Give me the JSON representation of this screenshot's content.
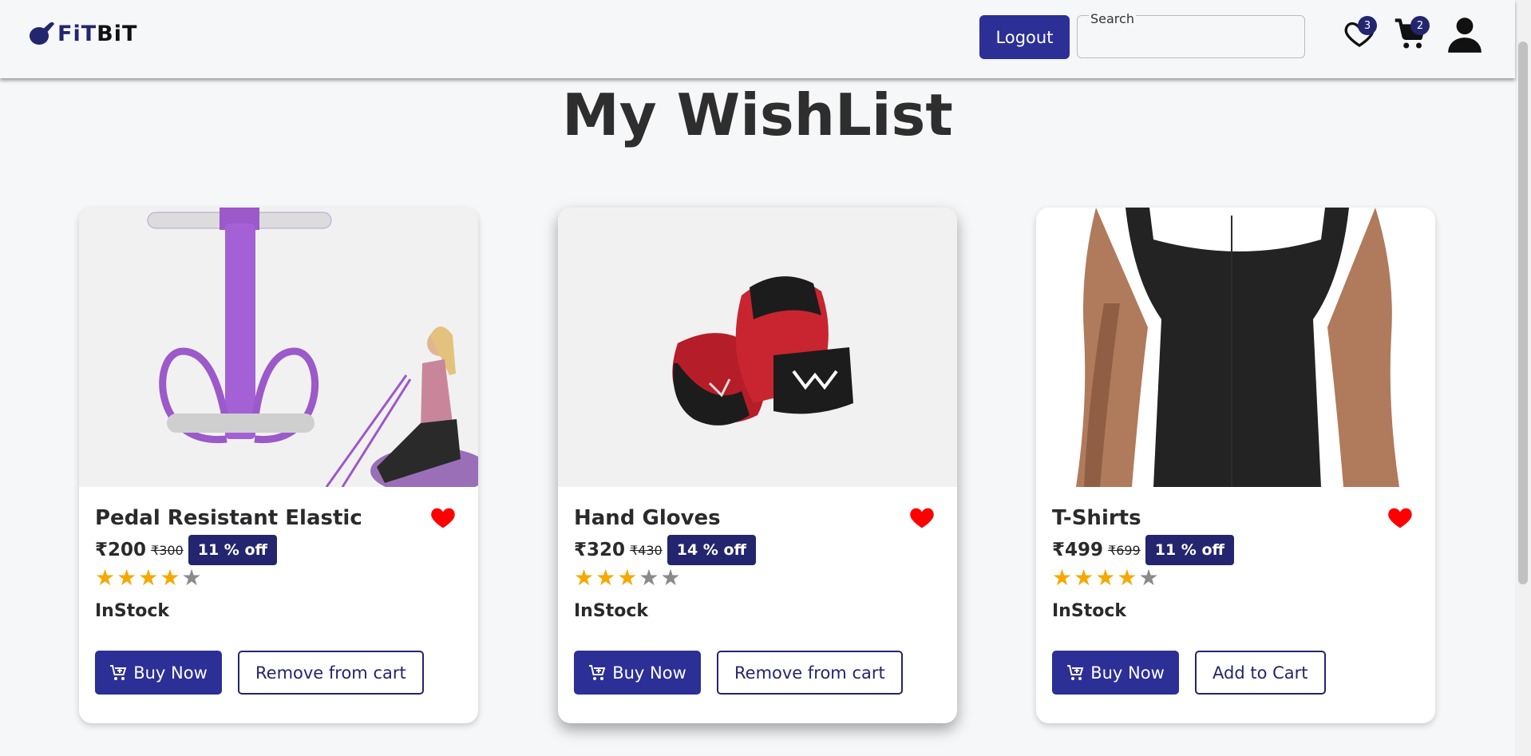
{
  "header": {
    "logo_prefix": "FiT",
    "logo_suffix": "BiT",
    "logout_label": "Logout",
    "search_label": "Search",
    "search_value": "",
    "wishlist_count": "3",
    "cart_count": "2"
  },
  "page_title": "My WishList",
  "products": [
    {
      "name": "Pedal Resistant Elastic",
      "price": "₹200",
      "mrp": "₹300",
      "discount": "11 % off",
      "rating": 4,
      "rating_max": 5,
      "stock": "InStock",
      "buy_label": "Buy Now",
      "secondary_label": "Remove from cart"
    },
    {
      "name": "Hand Gloves",
      "price": "₹320",
      "mrp": "₹430",
      "discount": "14 % off",
      "rating": 3,
      "rating_max": 5,
      "stock": "InStock",
      "buy_label": "Buy Now",
      "secondary_label": "Remove from cart"
    },
    {
      "name": "T-Shirts",
      "price": "₹499",
      "mrp": "₹699",
      "discount": "11 % off",
      "rating": 4,
      "rating_max": 5,
      "stock": "InStock",
      "buy_label": "Buy Now",
      "secondary_label": "Add to Cart"
    }
  ],
  "colors": {
    "brand": "#23256e",
    "button": "#2c2f96",
    "heart": "#ff0000",
    "star": "#f5a800"
  }
}
